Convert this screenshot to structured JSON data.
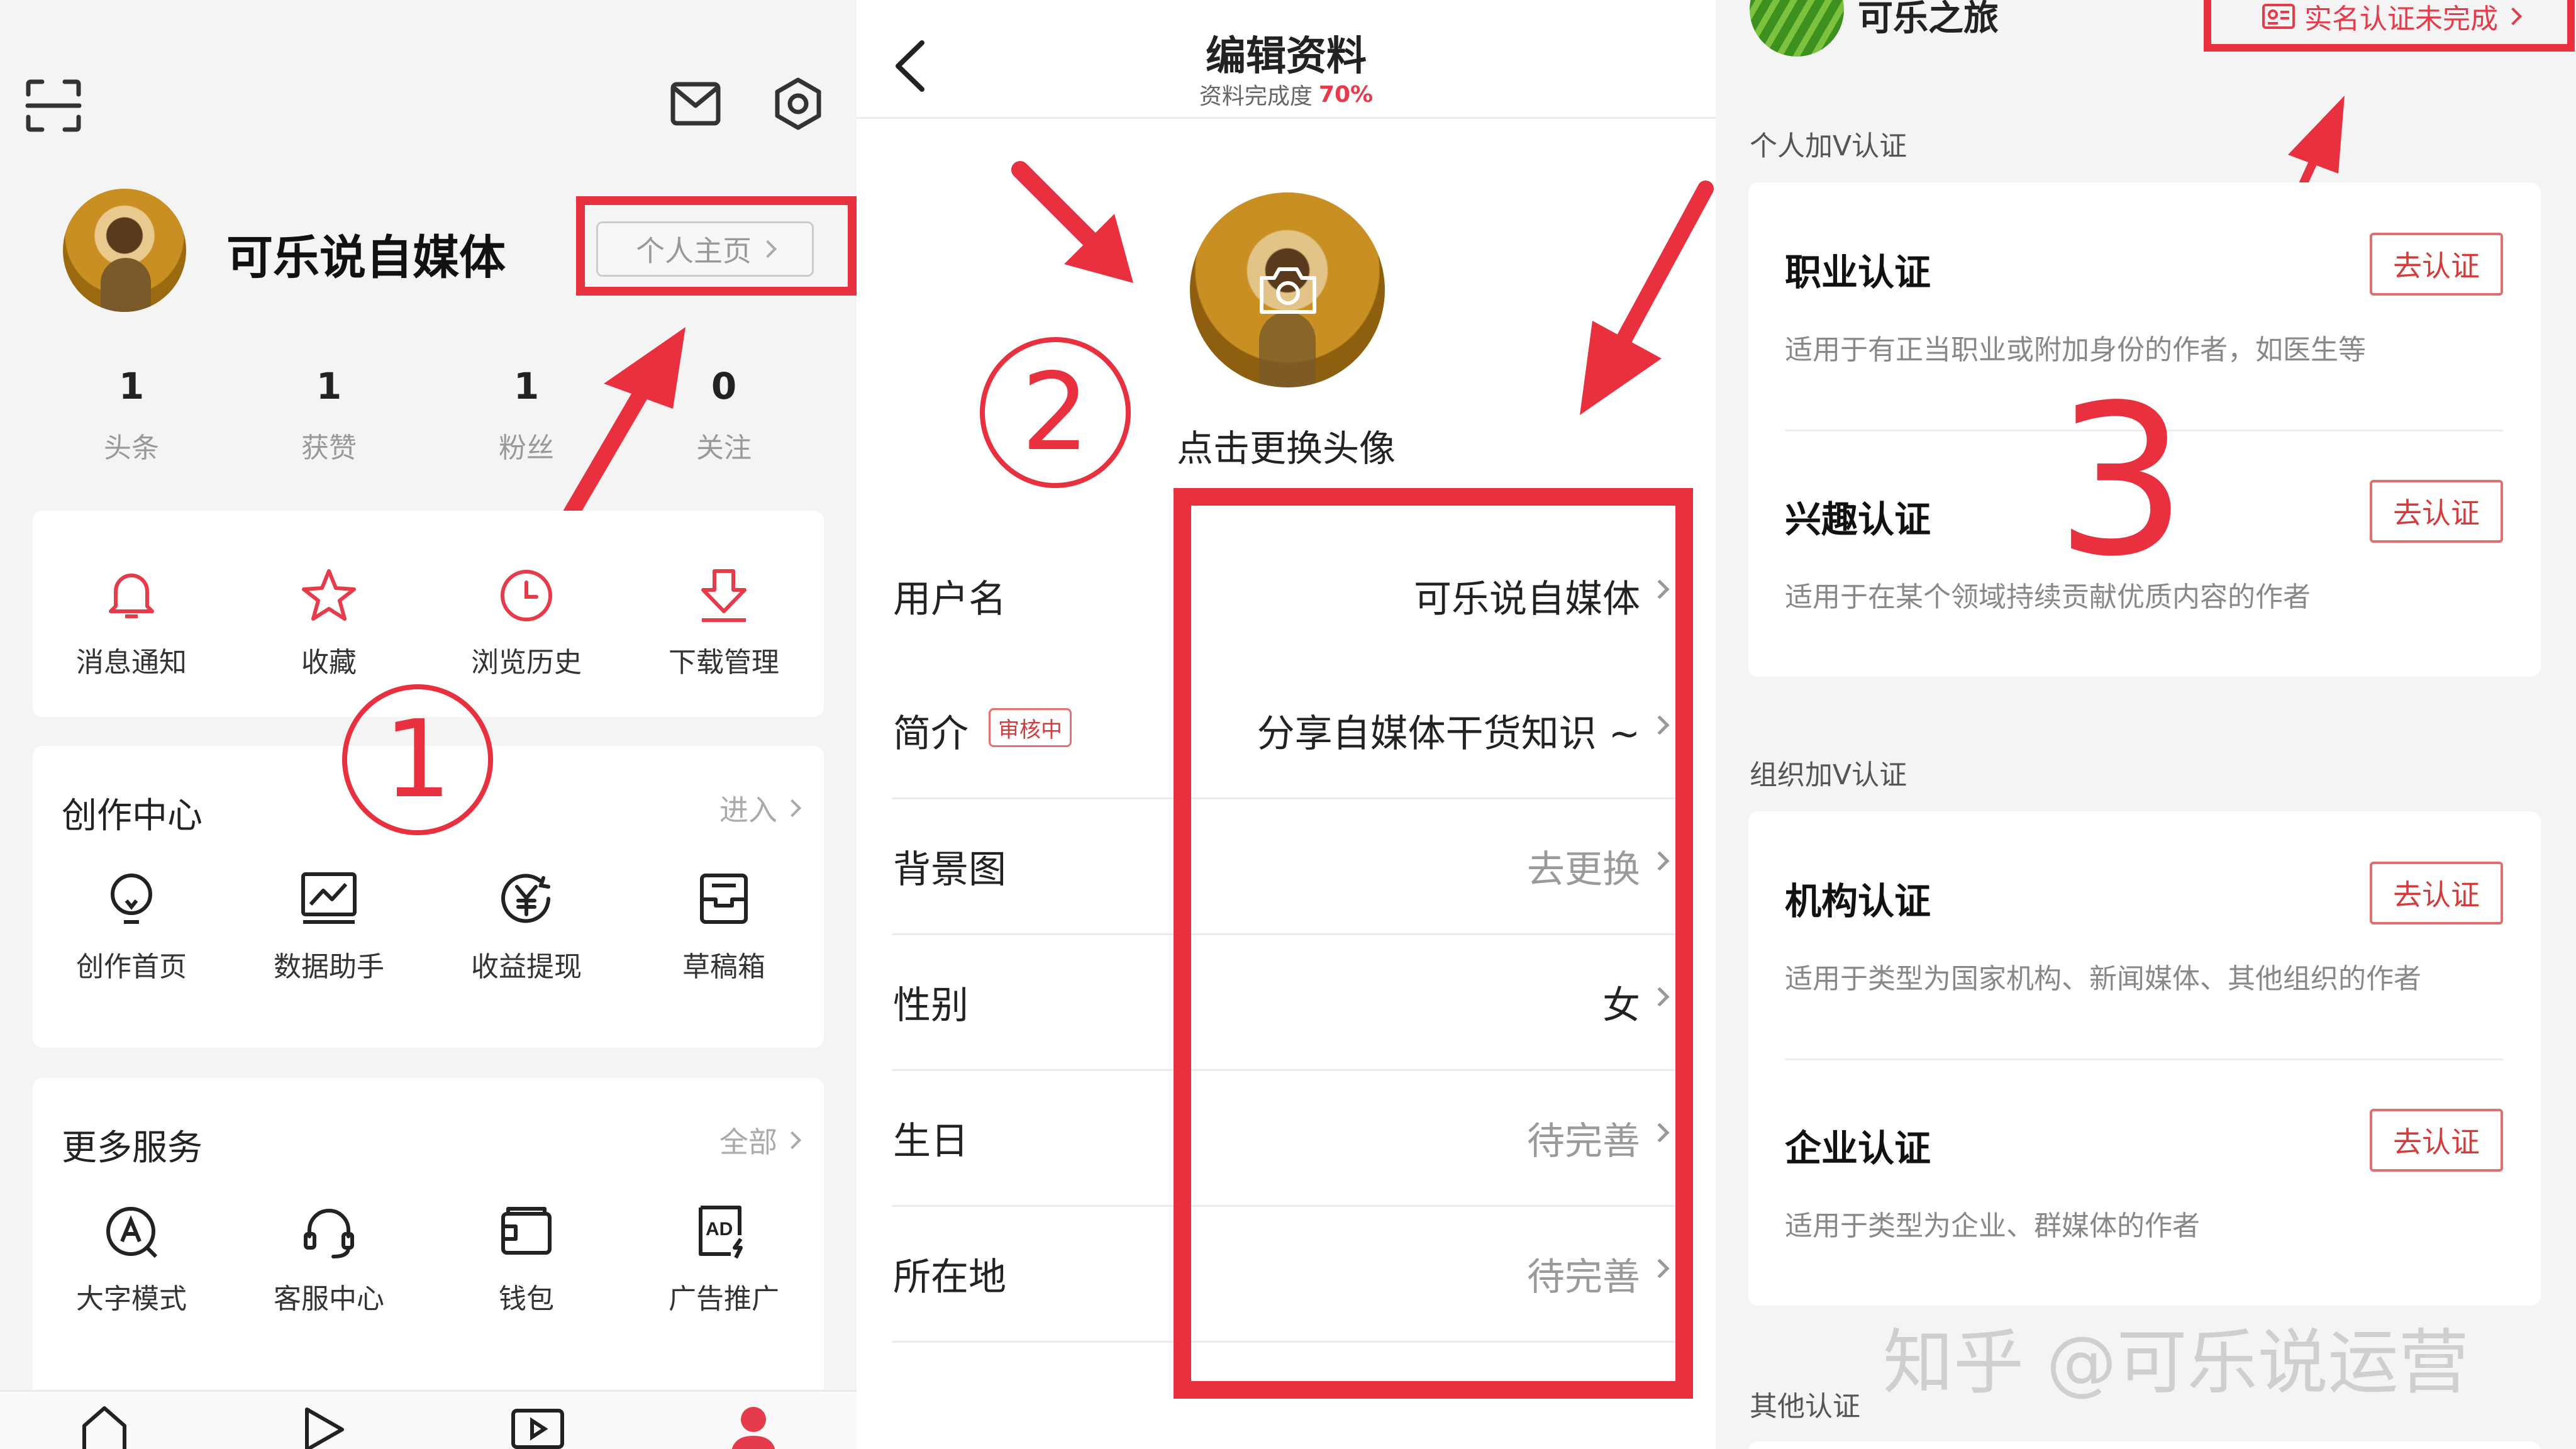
{
  "left": {
    "profile_name": "可乐说自媒体",
    "homepage_label": "个人主页",
    "stats": [
      {
        "value": "1",
        "label": "头条"
      },
      {
        "value": "1",
        "label": "获赞"
      },
      {
        "value": "1",
        "label": "粉丝"
      },
      {
        "value": "0",
        "label": "关注"
      }
    ],
    "quick": [
      {
        "label": "消息通知",
        "icon": "bell-icon"
      },
      {
        "label": "收藏",
        "icon": "star-icon"
      },
      {
        "label": "浏览历史",
        "icon": "clock-icon"
      },
      {
        "label": "下载管理",
        "icon": "download-icon"
      }
    ],
    "creation": {
      "title": "创作中心",
      "more": "进入",
      "items": [
        {
          "label": "创作首页",
          "icon": "lightbulb-icon"
        },
        {
          "label": "数据助手",
          "icon": "chart-icon"
        },
        {
          "label": "收益提现",
          "icon": "yuan-icon"
        },
        {
          "label": "草稿箱",
          "icon": "drafts-icon"
        }
      ]
    },
    "services": {
      "title": "更多服务",
      "more": "全部",
      "items": [
        {
          "label": "大字模式",
          "icon": "font-size-icon"
        },
        {
          "label": "客服中心",
          "icon": "headset-icon"
        },
        {
          "label": "钱包",
          "icon": "wallet-icon"
        },
        {
          "label": "广告推广",
          "icon": "ad-icon"
        }
      ]
    }
  },
  "middle": {
    "title": "编辑资料",
    "completion_label": "资料完成度",
    "completion_value": "70%",
    "avatar_hint": "点击更换头像",
    "review_badge": "审核中",
    "rows": [
      {
        "label": "用户名",
        "value": "可乐说自媒体",
        "empty": false
      },
      {
        "label": "简介",
        "value": "分享自媒体干货知识 ~",
        "empty": false
      },
      {
        "label": "背景图",
        "value": "去更换",
        "empty": true
      },
      {
        "label": "性别",
        "value": "女",
        "empty": false
      },
      {
        "label": "生日",
        "value": "待完善",
        "empty": true
      },
      {
        "label": "所在地",
        "value": "待完善",
        "empty": true
      }
    ]
  },
  "right": {
    "header_name": "可乐之旅",
    "verify_status": "实名认证未完成",
    "section_personal": "个人加V认证",
    "section_org": "组织加V认证",
    "section_other": "其他认证",
    "action_label": "去认证",
    "personal": [
      {
        "title": "职业认证",
        "desc": "适用于有正当职业或附加身份的作者，如医生等"
      },
      {
        "title": "兴趣认证",
        "desc": "适用于在某个领域持续贡献优质内容的作者"
      }
    ],
    "org": [
      {
        "title": "机构认证",
        "desc": "适用于类型为国家机构、新闻媒体、其他组织的作者"
      },
      {
        "title": "企业认证",
        "desc": "适用于类型为企业、群媒体的作者"
      }
    ]
  },
  "annotations": {
    "step1": "1",
    "step2": "2",
    "step3": "3"
  },
  "watermark": "知乎 @可乐说运营",
  "colors": {
    "accent": "#e53b4a",
    "highlight": "#e8303f"
  }
}
